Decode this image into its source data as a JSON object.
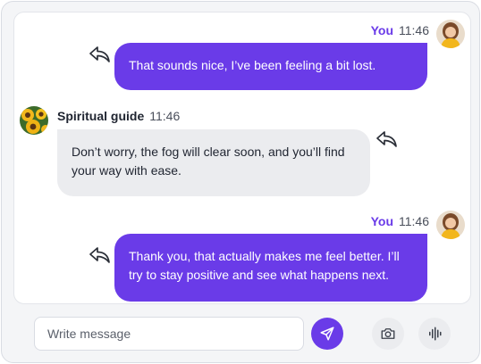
{
  "colors": {
    "accent": "#6a3be8",
    "incoming_bubble": "#ebecef",
    "panel_border": "#e3e5ea"
  },
  "messages": [
    {
      "sender": "You",
      "time": "11:46",
      "direction": "outgoing",
      "text": "That sounds nice, I’ve been feeling a bit lost.",
      "avatar_icon": "user-avatar-woman-yellow"
    },
    {
      "sender": "Spiritual guide",
      "time": "11:46",
      "direction": "incoming",
      "text": "Don’t worry, the fog will clear soon, and you’ll find your way with ease.",
      "avatar_icon": "sunflower-avatar"
    },
    {
      "sender": "You",
      "time": "11:46",
      "direction": "outgoing",
      "text": "Thank you, that actually makes me feel better. I’ll try to stay positive and see what happens next.",
      "avatar_icon": "user-avatar-woman-yellow"
    }
  ],
  "composer": {
    "placeholder": "Write message",
    "value": "",
    "send_icon": "send-icon",
    "camera_icon": "camera-icon",
    "voice_icon": "voice-waveform-icon"
  }
}
